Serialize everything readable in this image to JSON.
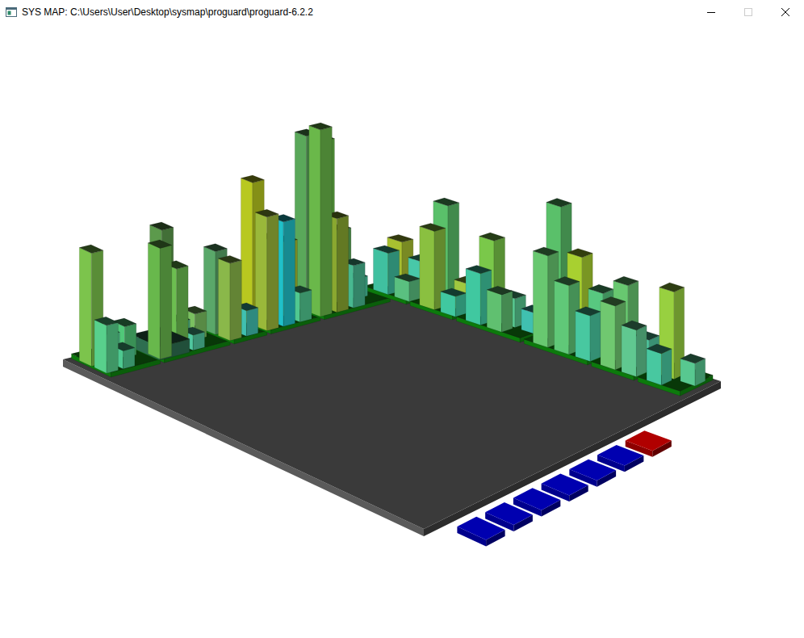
{
  "window": {
    "title": "SYS MAP: C:\\Users\\User\\Desktop\\sysmap\\proguard\\proguard-6.2.2",
    "maximize_disabled": true
  },
  "map": {
    "back_left_districts": [
      {
        "bars": [
          {
            "level": 0.5,
            "color": "#7cc44c",
            "kind": "tower"
          },
          {
            "level": 0.21,
            "color": "#58d08c",
            "kind": "tower"
          },
          {
            "level": 0.12,
            "color": "#60d8a0",
            "kind": "tower"
          },
          {
            "level": 0.08,
            "color": "#4ec890",
            "kind": "tower"
          },
          {
            "level": 0.14,
            "color": "#50c878",
            "kind": "tower"
          }
        ]
      },
      {
        "bars": [
          {
            "level": 0.06,
            "color": "#2e6e50",
            "kind": "slab"
          },
          {
            "level": 0.5,
            "color": "#68b84c",
            "kind": "tower"
          },
          {
            "level": 0.54,
            "color": "#5c9a4c",
            "kind": "tower"
          },
          {
            "level": 0.39,
            "color": "#6cbe50",
            "kind": "tower"
          },
          {
            "level": 0.1,
            "color": "#58c890",
            "kind": "tower"
          },
          {
            "level": 0.07,
            "color": "#50c8a0",
            "kind": "tower"
          },
          {
            "level": 0.12,
            "color": "#7ac060",
            "kind": "tower"
          }
        ]
      },
      {
        "bars": [
          {
            "level": 0.39,
            "color": "#5aa86a",
            "kind": "tower"
          },
          {
            "level": 0.36,
            "color": "#8ab84a",
            "kind": "tower"
          },
          {
            "level": 0.08,
            "color": "#50c8a0",
            "kind": "tower"
          },
          {
            "level": 0.12,
            "color": "#40c0b0",
            "kind": "tower"
          }
        ]
      },
      {
        "bars": [
          {
            "level": 0.68,
            "color": "#b8c820",
            "kind": "tower"
          },
          {
            "level": 0.54,
            "color": "#9ab83a",
            "kind": "tower"
          },
          {
            "level": 0.39,
            "color": "#6cb04a",
            "kind": "tower"
          },
          {
            "level": 0.5,
            "color": "#20c0c8",
            "kind": "tower"
          },
          {
            "level": 0.36,
            "color": "#a8c030",
            "kind": "tower"
          },
          {
            "level": 0.14,
            "color": "#50c890",
            "kind": "tower"
          }
        ]
      },
      {
        "bars": [
          {
            "level": 0.86,
            "color": "#5aa85a",
            "kind": "tower"
          },
          {
            "level": 0.91,
            "color": "#6ab84a",
            "kind": "tower"
          },
          {
            "level": 0.82,
            "color": "#6abe4a",
            "kind": "tower"
          },
          {
            "level": 0.46,
            "color": "#8aa830",
            "kind": "tower"
          },
          {
            "level": 0.36,
            "color": "#5aa858",
            "kind": "tower"
          },
          {
            "level": 0.21,
            "color": "#48b890",
            "kind": "tower"
          },
          {
            "level": 0.1,
            "color": "#4ac8a0",
            "kind": "tower"
          }
        ]
      }
    ],
    "back_right_districts": [
      {
        "bars": [
          {
            "level": 0.25,
            "color": "#a8c030",
            "kind": "tower"
          },
          {
            "level": 0.21,
            "color": "#40c0a0",
            "kind": "tower"
          },
          {
            "level": 0.18,
            "color": "#48c8a8",
            "kind": "tower"
          },
          {
            "level": 0.1,
            "color": "#5ac080",
            "kind": "tower"
          }
        ]
      },
      {
        "bars": [
          {
            "level": 0.5,
            "color": "#5ac06a",
            "kind": "tower"
          },
          {
            "level": 0.39,
            "color": "#8ac040",
            "kind": "tower"
          },
          {
            "level": 0.14,
            "color": "#a0c840",
            "kind": "tower"
          },
          {
            "level": 0.1,
            "color": "#40c8a0",
            "kind": "tower"
          }
        ]
      },
      {
        "bars": [
          {
            "level": 0.39,
            "color": "#7ac84a",
            "kind": "tower"
          },
          {
            "level": 0.25,
            "color": "#40c8a0",
            "kind": "tower"
          },
          {
            "level": 0.14,
            "color": "#58c890",
            "kind": "tower"
          },
          {
            "level": 0.18,
            "color": "#60c070",
            "kind": "tower"
          },
          {
            "level": 0.1,
            "color": "#40c0b0",
            "kind": "tower"
          }
        ]
      },
      {
        "bars": [
          {
            "level": 0.64,
            "color": "#5ac06a",
            "kind": "tower"
          },
          {
            "level": 0.43,
            "color": "#68c870",
            "kind": "tower"
          },
          {
            "level": 0.43,
            "color": "#a8d030",
            "kind": "tower"
          },
          {
            "level": 0.32,
            "color": "#60c878",
            "kind": "tower"
          },
          {
            "level": 0.29,
            "color": "#58c880",
            "kind": "tower"
          },
          {
            "level": 0.21,
            "color": "#48c8a0",
            "kind": "tower"
          }
        ]
      },
      {
        "bars": [
          {
            "level": 0.36,
            "color": "#68c870",
            "kind": "tower"
          },
          {
            "level": 0.29,
            "color": "#70c870",
            "kind": "tower"
          },
          {
            "level": 0.14,
            "color": "#50c8a0",
            "kind": "tower"
          },
          {
            "level": 0.21,
            "color": "#60c890",
            "kind": "tower"
          }
        ]
      },
      {
        "bars": [
          {
            "level": 0.39,
            "color": "#98d040",
            "kind": "tower"
          },
          {
            "level": 0.14,
            "color": "#48c8a0",
            "kind": "tower"
          },
          {
            "level": 0.1,
            "color": "#58c890",
            "kind": "tower"
          }
        ]
      }
    ],
    "markers": [
      {
        "color": "#0000b0"
      },
      {
        "color": "#0000b0"
      },
      {
        "color": "#0000b0"
      },
      {
        "color": "#0000b0"
      },
      {
        "color": "#0000b0"
      },
      {
        "color": "#0000b0"
      },
      {
        "color": "#b00000"
      }
    ]
  }
}
